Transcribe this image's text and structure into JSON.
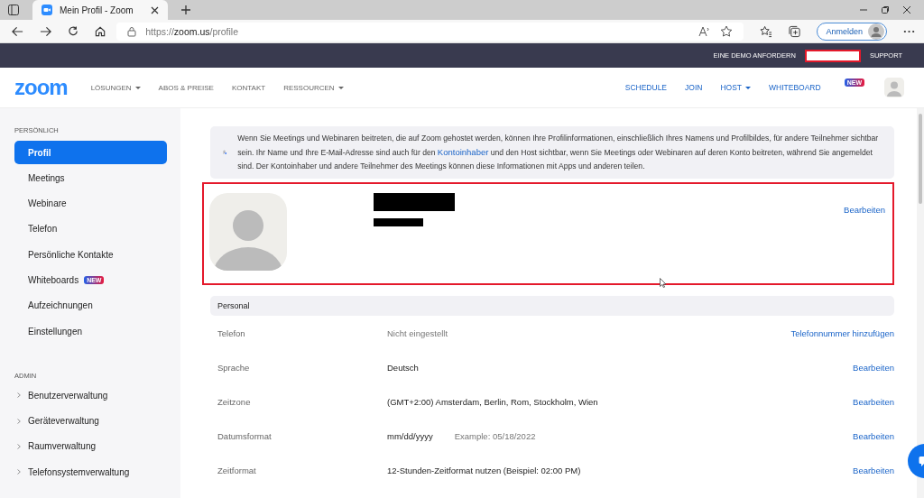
{
  "browser": {
    "tab_title": "Mein Profil - Zoom",
    "url_host": "zoom.us",
    "url_scheme": "https://",
    "url_path": "/profile",
    "sign_in": "Anmelden"
  },
  "top_bar": {
    "links": [
      "EINE DEMO ANFORDERN",
      "SUPPORT"
    ]
  },
  "nav": {
    "logo": "zoom",
    "left": [
      {
        "label": "LÖSUNGEN",
        "dropdown": true
      },
      {
        "label": "ABOS & PREISE",
        "dropdown": false
      },
      {
        "label": "KONTAKT",
        "dropdown": false
      },
      {
        "label": "RESSOURCEN",
        "dropdown": true
      }
    ],
    "right": [
      {
        "label": "SCHEDULE",
        "dropdown": false
      },
      {
        "label": "JOIN",
        "dropdown": false
      },
      {
        "label": "HOST",
        "dropdown": true
      },
      {
        "label": "WHITEBOARD",
        "dropdown": false,
        "badge": "NEW"
      }
    ]
  },
  "sidebar": {
    "sections": [
      {
        "heading": "PERSÖNLICH",
        "items": [
          {
            "label": "Profil",
            "selected": true,
            "kind": "link"
          },
          {
            "label": "Meetings",
            "selected": false,
            "kind": "link"
          },
          {
            "label": "Webinare",
            "selected": false,
            "kind": "link"
          },
          {
            "label": "Telefon",
            "selected": false,
            "kind": "link"
          },
          {
            "label": "Persönliche Kontakte",
            "selected": false,
            "kind": "link"
          },
          {
            "label": "Whiteboards",
            "selected": false,
            "kind": "link",
            "badge": "NEW"
          },
          {
            "label": "Aufzeichnungen",
            "selected": false,
            "kind": "link"
          },
          {
            "label": "Einstellungen",
            "selected": false,
            "kind": "link"
          }
        ]
      },
      {
        "heading": "ADMIN",
        "items": [
          {
            "label": "Benutzerverwaltung",
            "selected": false,
            "kind": "group",
            "expanded": false
          },
          {
            "label": "Geräteverwaltung",
            "selected": false,
            "kind": "group",
            "expanded": false
          },
          {
            "label": "Raumverwaltung",
            "selected": false,
            "kind": "group",
            "expanded": false
          },
          {
            "label": "Telefonsystemverwaltung",
            "selected": false,
            "kind": "group",
            "expanded": false
          }
        ]
      }
    ]
  },
  "notice": {
    "before": "Wenn Sie Meetings und Webinaren beitreten, die auf Zoom gehostet werden, können Ihre Profilinformationen, einschließlich Ihres Namens und Profilbildes, für andere Teilnehmer sichtbar sein. Ihr Name und Ihre E-Mail-Adresse sind auch für den",
    "link": "Kontoinhaber",
    "after": "und den Host sichtbar, wenn Sie Meetings oder Webinaren auf deren Konto beitreten, während Sie angemeldet sind. Der Kontoinhaber und andere Teilnehmer des Meetings können diese Informationen mit Apps und anderen teilen."
  },
  "profile": {
    "edit": "Bearbeiten"
  },
  "personal": {
    "heading": "Personal",
    "rows": [
      {
        "label": "Telefon",
        "value": "Nicht eingestellt",
        "muted": true,
        "action": "Telefonnummer hinzufügen"
      },
      {
        "label": "Sprache",
        "value": "Deutsch",
        "muted": false,
        "action": "Bearbeiten"
      },
      {
        "label": "Zeitzone",
        "value": "(GMT+2:00) Amsterdam, Berlin, Rom, Stockholm, Wien",
        "muted": false,
        "action": "Bearbeiten"
      },
      {
        "label": "Datumsformat",
        "value": "mm/dd/yyyy",
        "note": "Example: 05/18/2022",
        "muted": false,
        "action": "Bearbeiten"
      },
      {
        "label": "Zeitformat",
        "value": "12-Stunden-Zeitformat nutzen (Beispiel: 02:00 PM)",
        "muted": false,
        "action": "Bearbeiten"
      }
    ]
  }
}
